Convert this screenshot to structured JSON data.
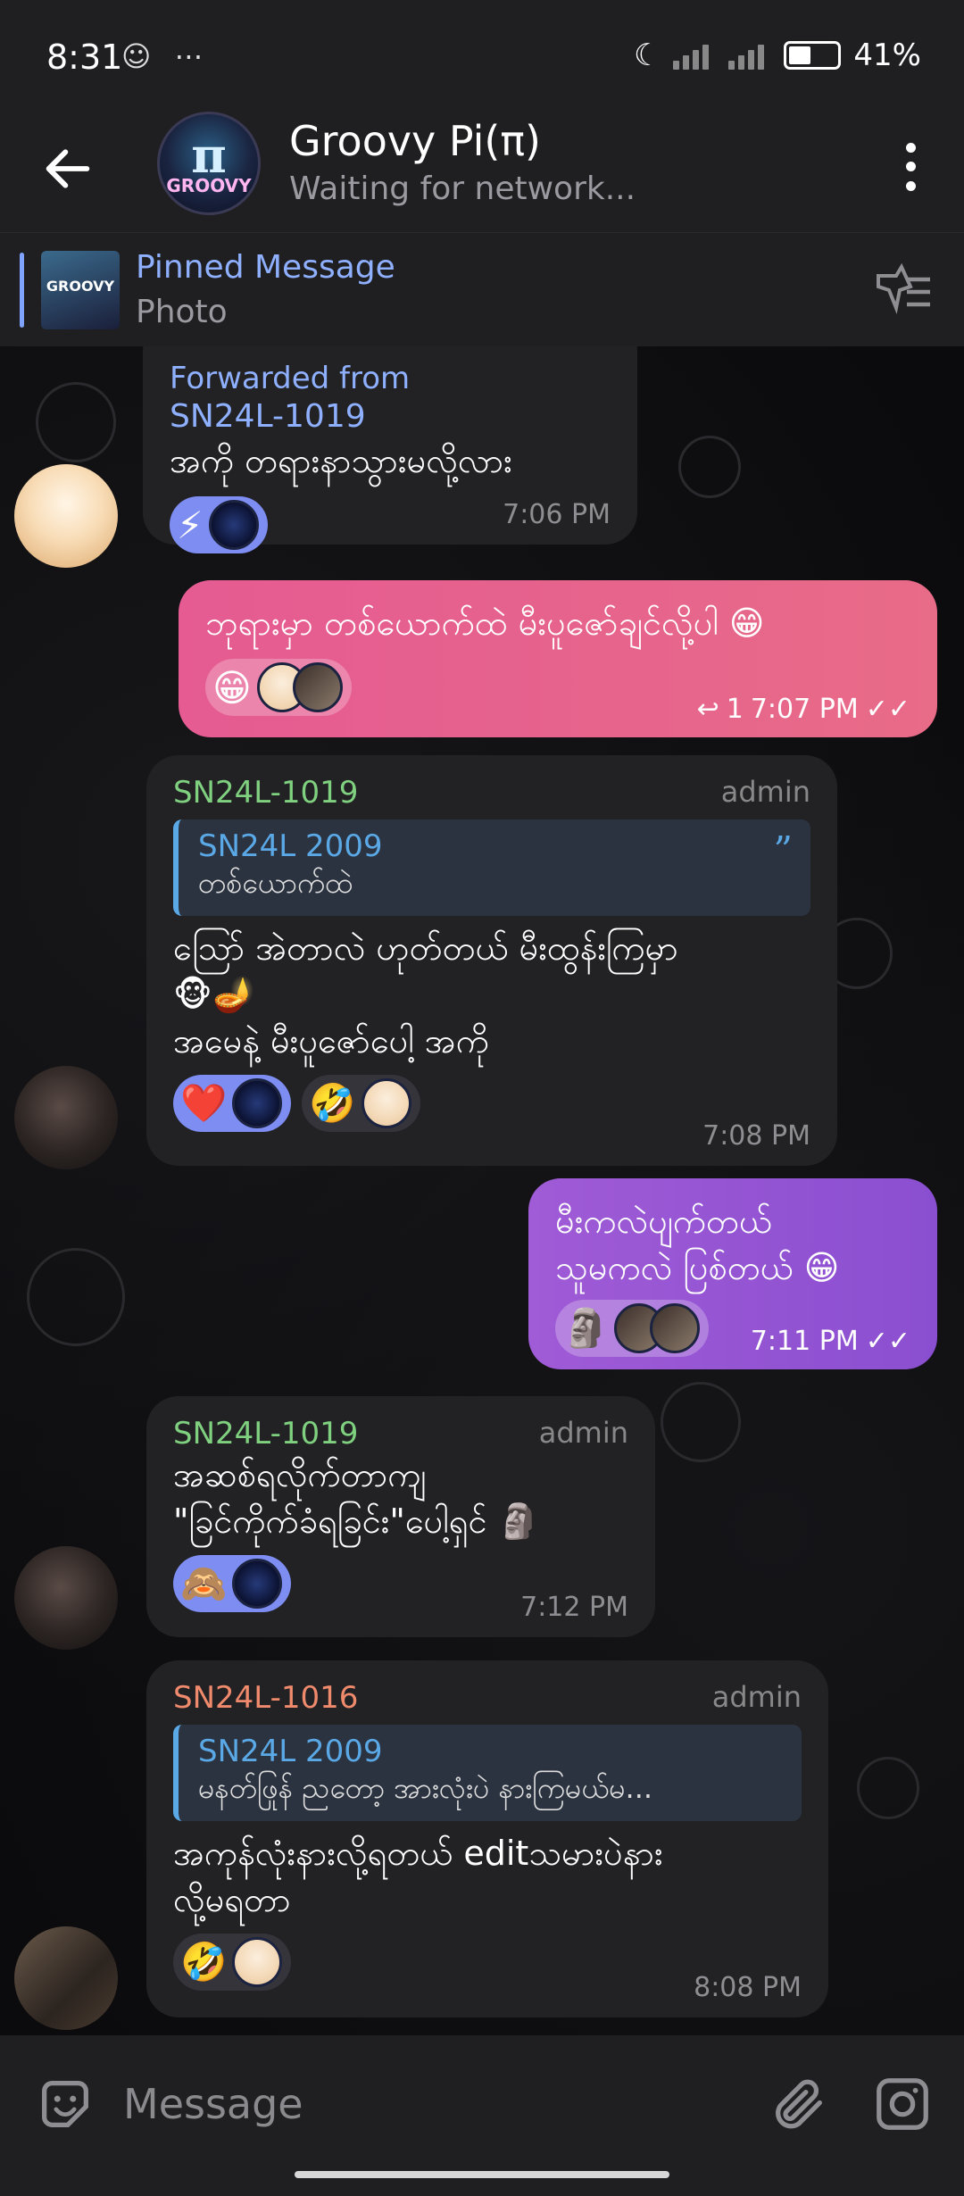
{
  "status": {
    "time": "8:31",
    "battery": "41%"
  },
  "header": {
    "title": "Groovy Pi(π)",
    "subtitle": "Waiting for network...",
    "avatar_text_top": "π",
    "avatar_text_bottom": "GROOVY"
  },
  "pinned": {
    "title": "Pinned Message",
    "subtitle": "Photo",
    "thumb_text": "GROOVY"
  },
  "messages": [
    {
      "forwarded_label": "Forwarded from",
      "forwarded_from": "SN24L-1019",
      "text": "အကို တရားနာသွားမလို့လား",
      "reactions": [
        "⚡"
      ],
      "time": "7:06 PM"
    },
    {
      "text": "ဘုရားမှာ တစ်ယောက်ထဲ မီးပူဇော်ချင်လို့ပါ 😁",
      "reactions": [
        "😁"
      ],
      "reply_count": "1",
      "time": "7:07 PM"
    },
    {
      "sender": "SN24L-1019",
      "role": "admin",
      "reply_name": "SN24L 2009",
      "reply_text": "တစ်ယောက်ထဲ",
      "text": "ဩော် အဲတာလဲ ဟုတ်တယ် မီးထွန်းကြမှာ\n🐵🪔\nအမေနဲ့ မီးပူဇော်ပေါ့ အကို",
      "reactions": [
        "❤️",
        "🤣"
      ],
      "time": "7:08 PM"
    },
    {
      "text": "မီးကလဲပျက်တယ်\nသူမကလဲ ပြစ်တယ် 😁",
      "reactions": [
        "🗿"
      ],
      "time": "7:11 PM"
    },
    {
      "sender": "SN24L-1019",
      "role": "admin",
      "text": "အဆစ်ရလိုက်တာကျ\n\"ခြင်ကိုက်ခံရခြင်း\"ပေါ့ရှင် 🗿",
      "reactions": [
        "🙈"
      ],
      "time": "7:12 PM"
    },
    {
      "sender": "SN24L-1016",
      "role": "admin",
      "reply_name": "SN24L 2009",
      "reply_text": "မနတ်ဖြုန် ညတော့ အားလုံးပဲ နားကြမယ်မ...",
      "text": "အကုန်လုံးနားလို့ရတယ် editသမားပဲနား\nလို့မရတာ",
      "reactions": [
        "🤣"
      ],
      "time": "8:08 PM"
    }
  ],
  "composer": {
    "placeholder": "Message"
  },
  "colors": {
    "accent": "#7fa3ff",
    "pink": "#e55b92",
    "purple": "#9a56d4",
    "reaction": "#7e8df2"
  },
  "icons": [
    "back-arrow-icon",
    "more-vert-icon",
    "unpin-icon",
    "emoji-icon",
    "attach-icon",
    "camera-icon",
    "double-check-icon",
    "reply-arrow-icon",
    "quote-icon"
  ]
}
